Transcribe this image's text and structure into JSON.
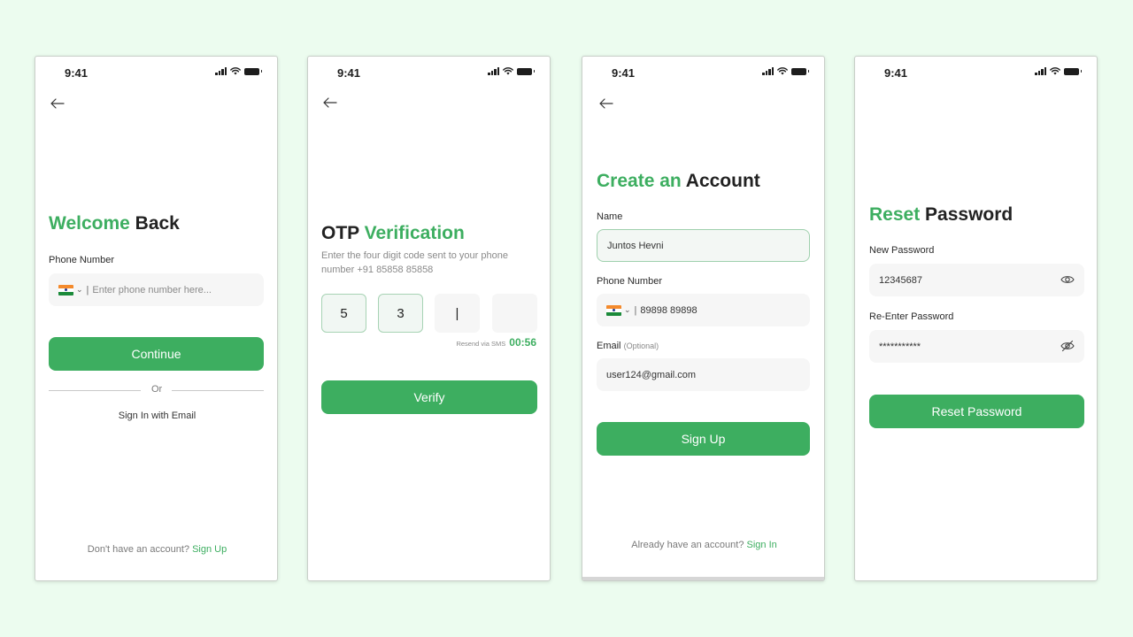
{
  "status_bar": {
    "time": "9:41"
  },
  "login": {
    "title_green": "Welcome",
    "title_dark": " Back",
    "phone_label": "Phone Number",
    "phone_placeholder": "Enter phone number here...",
    "continue_label": "Continue",
    "or_label": "Or",
    "email_signin_label": "Sign In with Email",
    "footer_text": "Don't have an account? ",
    "footer_link": "Sign Up"
  },
  "otp": {
    "title_dark": "OTP ",
    "title_green": "Verification",
    "description": "Enter the four digit code sent to your phone number +91 85858 85858",
    "digits": [
      "5",
      "3",
      "|",
      ""
    ],
    "resend_label": "Resend via SMS",
    "timer": "00:56",
    "verify_label": "Verify"
  },
  "signup": {
    "title_green": "Create an",
    "title_dark": " Account",
    "name_label": "Name",
    "name_value": "Juntos Hevni",
    "phone_label": "Phone Number",
    "phone_value": "89898 89898",
    "email_label": "Email",
    "email_optional": "(Optional)",
    "email_value": "user124@gmail.com",
    "signup_label": "Sign Up",
    "footer_text": "Already have an account? ",
    "footer_link": "Sign In"
  },
  "reset": {
    "title_green": "Reset",
    "title_dark": " Password",
    "new_label": "New Password",
    "new_value": "12345687",
    "reenter_label": "Re-Enter Password",
    "reenter_value": "***********",
    "button_label": "Reset Password"
  },
  "icons": {
    "back": "arrow-left-icon",
    "signal": "signal-icon",
    "wifi": "wifi-icon",
    "battery": "battery-icon",
    "flag": "india-flag-icon",
    "eye": "eye-icon",
    "eye_off": "eye-off-icon"
  },
  "colors": {
    "background": "#ecfcef",
    "accent": "#3dae60",
    "field": "#f6f6f6"
  }
}
